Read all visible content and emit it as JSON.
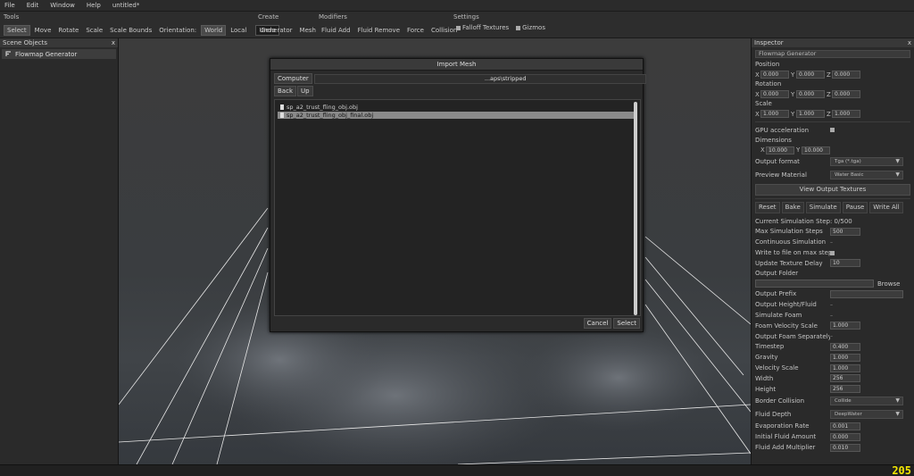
{
  "menu": [
    "File",
    "Edit",
    "Window",
    "Help",
    "untitled*"
  ],
  "toolbar": {
    "tools_title": "Tools",
    "tools": [
      "Select",
      "Move",
      "Rotate",
      "Scale",
      "Scale Bounds"
    ],
    "orientation_label": "Orientation:",
    "world": "World",
    "local": "Local",
    "undo": "Undo",
    "create_title": "Create",
    "create": [
      "Generator",
      "Mesh"
    ],
    "modifiers_title": "Modifiers",
    "modifiers": [
      "Fluid Add",
      "Fluid Remove",
      "Force",
      "Collision"
    ],
    "settings_title": "Settings",
    "settings": [
      "Falloff Textures",
      "Gizmos"
    ]
  },
  "scene_objects": {
    "title": "Scene Objects",
    "close": "x",
    "items": [
      "Flowmap Generator"
    ]
  },
  "dialog": {
    "title": "Import Mesh",
    "location": "Computer",
    "path": "...aps\\stripped",
    "back": "Back",
    "up": "Up",
    "files": [
      "sp_a2_trust_fling_obj.obj",
      "sp_a2_trust_fling_obj_final.obj"
    ],
    "cancel": "Cancel",
    "select": "Select"
  },
  "inspector": {
    "title": "Inspector",
    "close": "x",
    "object_name": "Flowmap Generator",
    "position_label": "Position",
    "position": [
      "0.000",
      "0.000",
      "0.000"
    ],
    "rotation_label": "Rotation",
    "rotation": [
      "0.000",
      "0.000",
      "0.000"
    ],
    "scale_label": "Scale",
    "scale": [
      "1.000",
      "1.000",
      "1.000"
    ],
    "gpu_label": "GPU acceleration",
    "dimensions_label": "Dimensions",
    "dimensions": [
      "10.000",
      "10.000"
    ],
    "output_format_label": "Output format",
    "output_format": "Tga (*.tga)",
    "preview_material_label": "Preview Material",
    "preview_material": "Water Basic",
    "view_output": "View Output Textures",
    "sim_buttons": [
      "Reset",
      "Bake",
      "Simulate",
      "Pause",
      "Write All"
    ],
    "current_step": "Current Simulation Step: 0/500",
    "max_steps_label": "Max Simulation Steps",
    "max_steps": "500",
    "continuous_label": "Continuous Simulation",
    "write_file_label": "Write to file on max steps",
    "update_delay_label": "Update Texture Delay",
    "update_delay": "10",
    "output_folder_label": "Output Folder",
    "browse": "Browse",
    "output_prefix_label": "Output Prefix",
    "output_height_label": "Output Height/Fluid",
    "simulate_foam_label": "Simulate Foam",
    "foam_velocity_label": "Foam Velocity Scale",
    "foam_velocity": "1.000",
    "output_foam_label": "Output Foam Separately",
    "timestep_label": "Timestep",
    "timestep": "0.400",
    "gravity_label": "Gravity",
    "gravity": "1.000",
    "velocity_scale_label": "Velocity Scale",
    "velocity_scale": "1.000",
    "width_label": "Width",
    "width": "256",
    "height_label": "Height",
    "height": "256",
    "border_collision_label": "Border Collision",
    "border_collision": "Collide",
    "fluid_depth_label": "Fluid Depth",
    "fluid_depth": "DeepWater",
    "evaporation_label": "Evaporation Rate",
    "evaporation": "0.001",
    "initial_fluid_label": "Initial Fluid Amount",
    "initial_fluid": "0.000",
    "fluid_add_mult_label": "Fluid Add Multiplier",
    "fluid_add_mult": "0.010"
  },
  "fps": "205"
}
